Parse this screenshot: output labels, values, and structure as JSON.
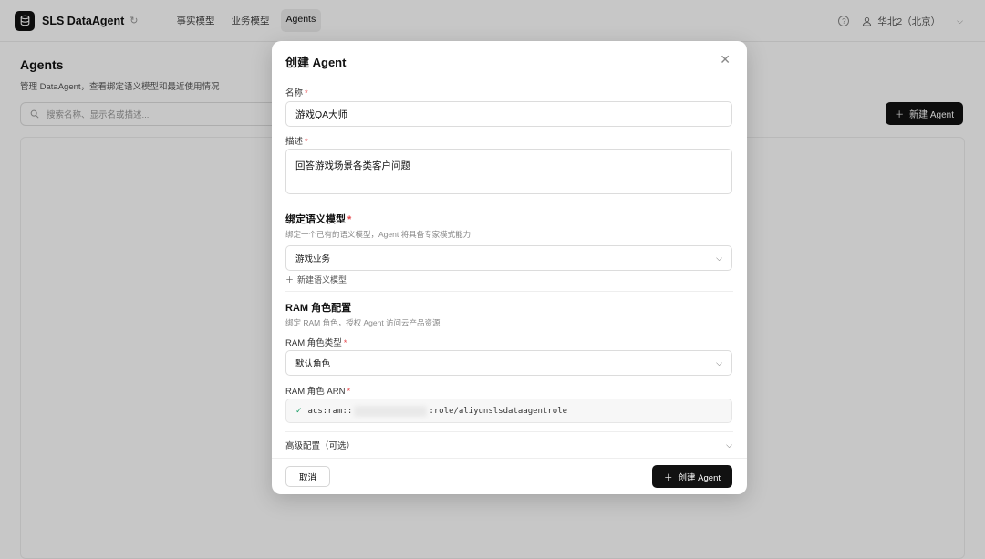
{
  "topbar": {
    "brand": "SLS DataAgent",
    "refresh_glyph": "↻",
    "nav": [
      {
        "label": "事实模型",
        "active": false
      },
      {
        "label": "业务模型",
        "active": false
      },
      {
        "label": "Agents",
        "active": true
      }
    ],
    "help_glyph": "?",
    "region": "华北2（北京）"
  },
  "page": {
    "title": "Agents",
    "description": "管理 DataAgent，查看绑定语义模型和最近使用情况",
    "search_placeholder": "搜索名称、显示名或描述...",
    "new_agent_label": "新建 Agent"
  },
  "modal": {
    "title": "创建 Agent",
    "name": {
      "label": "名称",
      "value": "游戏QA大师"
    },
    "description": {
      "label": "描述",
      "value": "回答游戏场景各类客户问题"
    },
    "semantic_model": {
      "section_title": "绑定语义模型",
      "hint": "绑定一个已有的语义模型，Agent 将具备专家模式能力",
      "selected": "游戏业务",
      "add_label": "新建语义模型"
    },
    "ram": {
      "section_title": "RAM 角色配置",
      "hint": "绑定 RAM 角色，授权 Agent 访问云产品资源",
      "role_type_label": "RAM 角色类型",
      "role_type_value": "默认角色",
      "arn_label": "RAM 角色 ARN",
      "arn_prefix": "acs:ram::",
      "arn_suffix": ":role/aliyunslsdataagentrole"
    },
    "advanced_label": "高级配置（可选）",
    "cancel_label": "取消",
    "create_label": "创建 Agent"
  },
  "colors": {
    "primary": "#111111",
    "required": "#e5484d",
    "check": "#22a06b"
  },
  "icons": [
    "database-icon",
    "refresh-icon",
    "help-icon",
    "user-icon",
    "chevron-down-icon",
    "search-icon",
    "plus-icon",
    "close-icon",
    "check-icon"
  ]
}
